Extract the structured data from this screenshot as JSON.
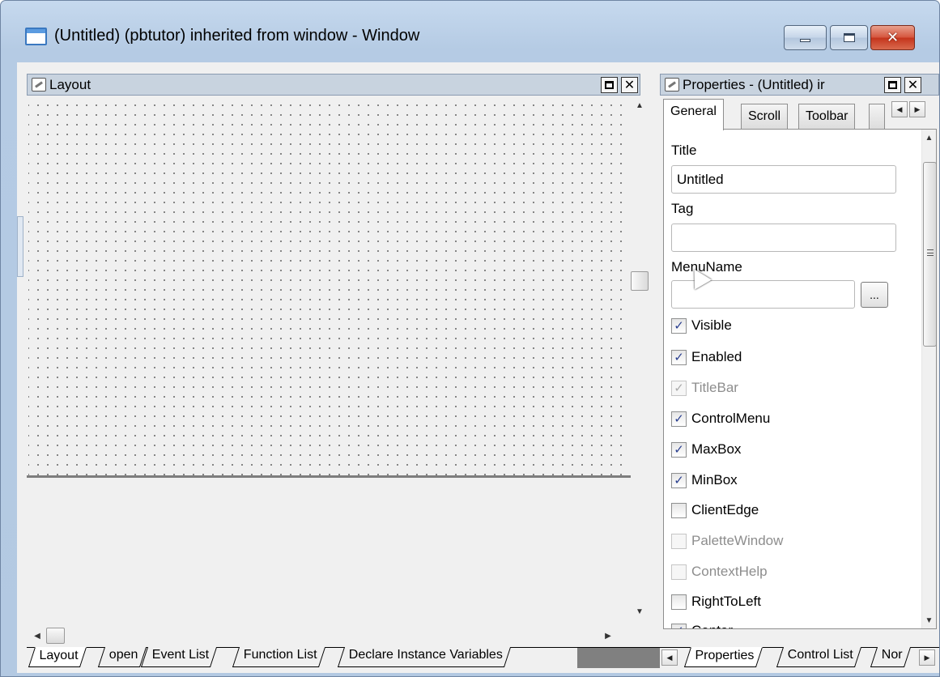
{
  "window": {
    "title": "(Untitled) (pbtutor) inherited from window - Window",
    "buttons": {
      "minimize": "minimize",
      "maximize": "maximize",
      "close": "close"
    }
  },
  "layout_pane": {
    "title": "Layout",
    "header_buttons": {
      "maximize": "□",
      "close": "✕"
    },
    "tabs": [
      "Layout",
      "open",
      "Event List",
      "Function List",
      "Declare Instance Variables"
    ],
    "active_tab": "Layout"
  },
  "properties_pane": {
    "title": "Properties -  (Untitled)  ir",
    "header_buttons": {
      "maximize": "□",
      "close": "✕"
    },
    "tabs": [
      "General",
      "Scroll",
      "Toolbar"
    ],
    "active_tab": "General",
    "fields": {
      "title_label": "Title",
      "title_value": "Untitled",
      "tag_label": "Tag",
      "tag_value": "",
      "menuname_label": "MenuName",
      "menuname_value": "",
      "browse_label": "..."
    },
    "checkboxes": [
      {
        "label": "Visible",
        "checked": true,
        "enabled": true
      },
      {
        "label": "Enabled",
        "checked": true,
        "enabled": true
      },
      {
        "label": "TitleBar",
        "checked": true,
        "enabled": false
      },
      {
        "label": "ControlMenu",
        "checked": true,
        "enabled": true
      },
      {
        "label": "MaxBox",
        "checked": true,
        "enabled": true
      },
      {
        "label": "MinBox",
        "checked": true,
        "enabled": true
      },
      {
        "label": "ClientEdge",
        "checked": false,
        "enabled": true
      },
      {
        "label": "PaletteWindow",
        "checked": false,
        "enabled": false
      },
      {
        "label": "ContextHelp",
        "checked": false,
        "enabled": false
      },
      {
        "label": "RightToLeft",
        "checked": false,
        "enabled": true
      },
      {
        "label": "Center",
        "checked": true,
        "enabled": true
      }
    ],
    "bottom_tabs": [
      "Properties",
      "Control List",
      "Nor"
    ],
    "active_bottom_tab": "Properties"
  },
  "icons": {
    "app": "window-icon",
    "pin": "pin-icon",
    "checkmark": "✓"
  }
}
